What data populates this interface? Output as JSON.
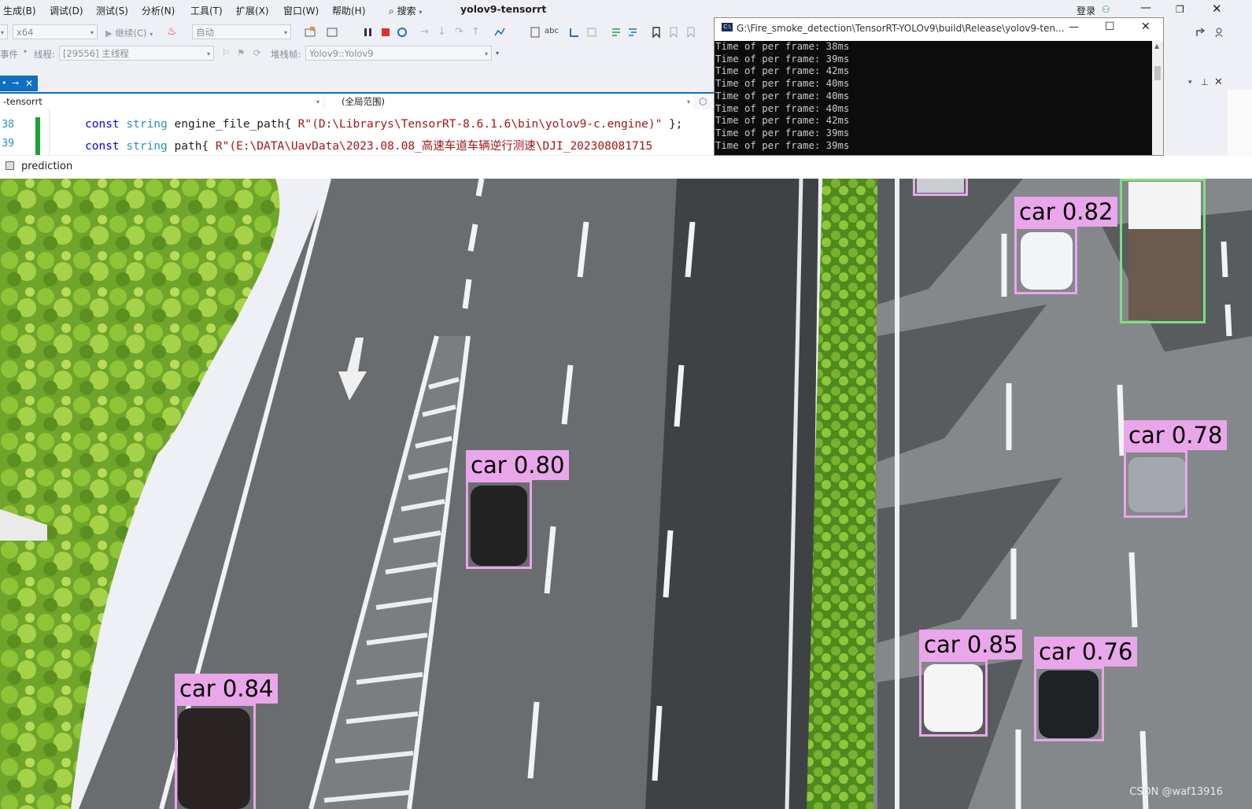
{
  "menubar": {
    "items": [
      "生成(B)",
      "调试(D)",
      "测试(S)",
      "分析(N)",
      "工具(T)",
      "扩展(X)",
      "窗口(W)",
      "帮助(H)"
    ],
    "search_label": "搜索",
    "title": "yolov9-tensorrt",
    "signin_label": "登录"
  },
  "toolbar1": {
    "platform": "x64",
    "continue_label": "继续(C)",
    "config": "自动"
  },
  "toolbar2": {
    "events_label": "事件",
    "thread_label": "线程:",
    "thread_value": "[29556] 主线程",
    "stackframe_label": "堆栈帧:",
    "stackframe_value": "Yolov9::Yolov9"
  },
  "editor": {
    "file_combo": "-tensorrt",
    "scope_combo": "(全局范围)",
    "lines": [
      {
        "num": "38",
        "kw": "const",
        "type": "string",
        "ident": "engine_file_path{",
        "str": "R\"(D:\\Librarys\\TensorRT-8.6.1.6\\bin\\yolov9-c.engine)\"",
        "end": "};"
      },
      {
        "num": "39",
        "kw": "const",
        "type": "string",
        "ident": "path{",
        "str": "R\"(E:\\DATA\\UavData\\2023.08.08_高速车道车辆逆行测速\\DJI_202308081715",
        "end": ""
      }
    ]
  },
  "console": {
    "title": "G:\\Fire_smoke_detection\\TensorRT-YOLOv9\\build\\Release\\yolov9-ten...",
    "lines": [
      "Time of per frame: 38ms",
      "Time of per frame: 39ms",
      "Time of per frame: 42ms",
      "Time of per frame: 40ms",
      "Time of per frame: 40ms",
      "Time of per frame: 40ms",
      "Time of per frame: 42ms",
      "Time of per frame: 39ms",
      "Time of per frame: 39ms"
    ]
  },
  "prediction": {
    "title": "prediction",
    "watermark": "CSDN @waf13916",
    "detections": [
      {
        "label": "car 0.82"
      },
      {
        "label": "car 0.78"
      },
      {
        "label": "car 0.80"
      },
      {
        "label": "car 0.84"
      },
      {
        "label": "car 0.85"
      },
      {
        "label": "car 0.76"
      }
    ]
  },
  "colors": {
    "det_box": "#eaa6ea",
    "truck_box": "#7ee07e",
    "accent": "#0e70c0"
  }
}
